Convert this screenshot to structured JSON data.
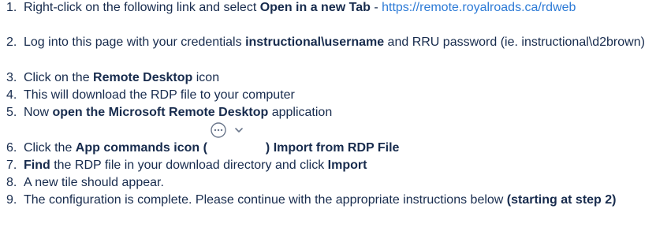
{
  "steps": [
    {
      "number": "1.",
      "text_before": "Right-click on the following link and select ",
      "bold": "Open in a new Tab",
      "text_mid": " - ",
      "link": "https://remote.royalroads.ca/rdweb"
    },
    {
      "number": "2.",
      "text_before": "Log into this page with your credentials ",
      "bold": "instructional\\username",
      "text_after": " and RRU password (ie. instructional\\d2brown)"
    },
    {
      "number": "3.",
      "text_before": "Click on the ",
      "bold": "Remote Desktop",
      "text_after": " icon"
    },
    {
      "number": "4.",
      "text": "This will download the RDP file to your computer"
    },
    {
      "number": "5.",
      "text_before": "Now ",
      "bold": "open the Microsoft Remote Desktop",
      "text_after": " application"
    },
    {
      "number": "6.",
      "text_before": "Click the ",
      "bold_before_icon": "App commands icon (",
      "bold_after_icon": ") Import from RDP File",
      "icon": "app-commands-ellipsis-icon"
    },
    {
      "number": "7.",
      "bold_first": "Find",
      "text_mid": " the RDP file in your download directory and click ",
      "bold_last": "Import"
    },
    {
      "number": "8.",
      "text": "A new tile should appear."
    },
    {
      "number": "9.",
      "text_before": "The configuration is complete. Please continue with the appropriate instructions below ",
      "bold": "(starting at step 2)"
    }
  ],
  "colors": {
    "text": "#172b4d",
    "link": "#2e7bd6",
    "icon_stroke": "#6b778c"
  }
}
